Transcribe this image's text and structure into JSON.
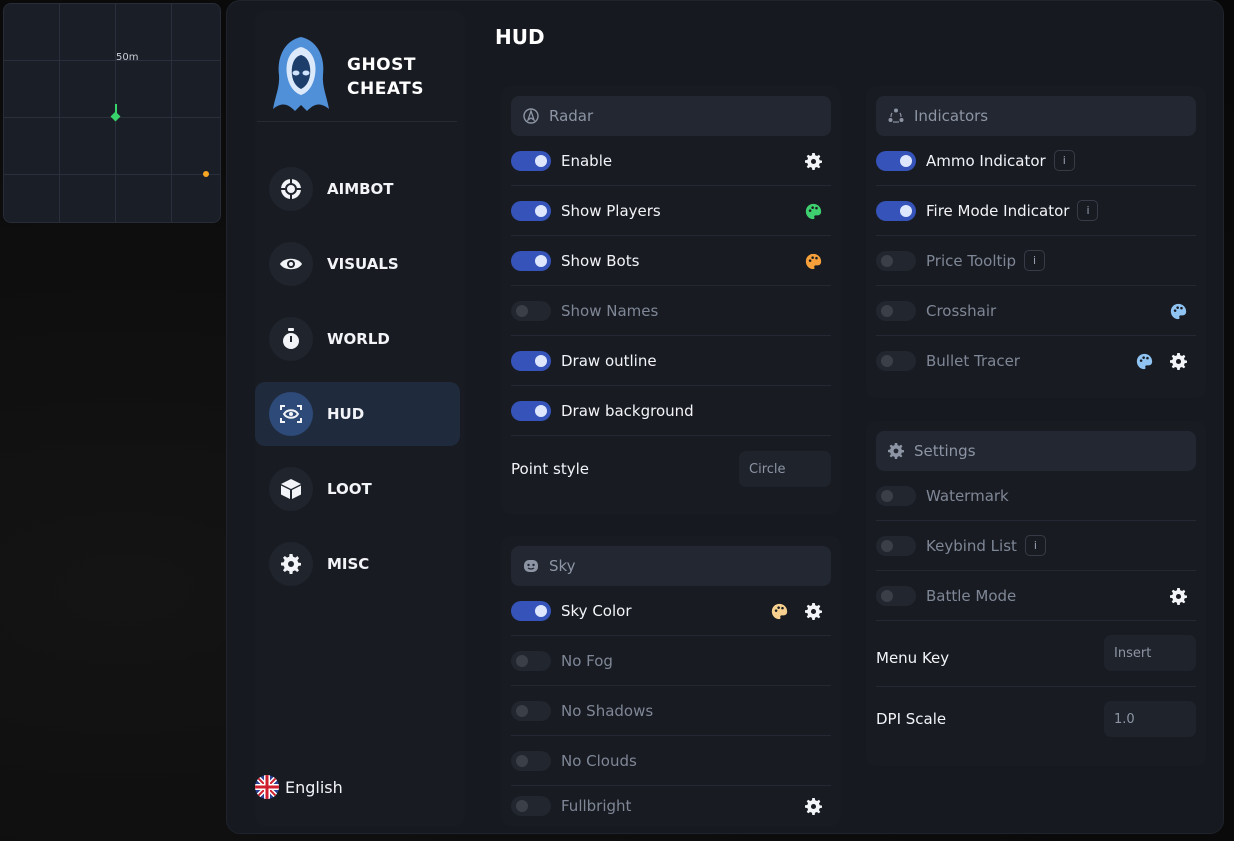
{
  "radar": {
    "range_label": "50m"
  },
  "brand": {
    "line1": "GHOST",
    "line2": "CHEATS"
  },
  "nav": [
    {
      "label": "AIMBOT",
      "icon": "crosshair-icon"
    },
    {
      "label": "VISUALS",
      "icon": "eye-icon"
    },
    {
      "label": "WORLD",
      "icon": "stopwatch-icon"
    },
    {
      "label": "HUD",
      "icon": "hud-eye-icon",
      "active": true
    },
    {
      "label": "LOOT",
      "icon": "box-icon"
    },
    {
      "label": "MISC",
      "icon": "gear-icon"
    }
  ],
  "language": {
    "label": "English"
  },
  "page_title": "HUD",
  "radar_panel": {
    "title": "Radar",
    "rows": [
      {
        "label": "Enable",
        "on": true
      },
      {
        "label": "Show Players",
        "on": true
      },
      {
        "label": "Show Bots",
        "on": true
      },
      {
        "label": "Show Names",
        "on": false
      },
      {
        "label": "Draw outline",
        "on": true
      },
      {
        "label": "Draw background",
        "on": true
      }
    ],
    "point_style": {
      "label": "Point style",
      "value": "Circle"
    }
  },
  "sky_panel": {
    "title": "Sky",
    "rows": [
      {
        "label": "Sky Color",
        "on": true
      },
      {
        "label": "No Fog",
        "on": false
      },
      {
        "label": "No Shadows",
        "on": false
      },
      {
        "label": "No Clouds",
        "on": false
      },
      {
        "label": "Fullbright",
        "on": false
      }
    ]
  },
  "indicators_panel": {
    "title": "Indicators",
    "rows": [
      {
        "label": "Ammo Indicator",
        "on": true,
        "info": "i"
      },
      {
        "label": "Fire Mode Indicator",
        "on": true,
        "info": "i"
      },
      {
        "label": "Price Tooltip",
        "on": false,
        "info": "i"
      },
      {
        "label": "Crosshair",
        "on": false
      },
      {
        "label": "Bullet Tracer",
        "on": false
      }
    ]
  },
  "settings_panel": {
    "title": "Settings",
    "rows": [
      {
        "label": "Watermark",
        "on": false
      },
      {
        "label": "Keybind List",
        "on": false,
        "info": "i"
      },
      {
        "label": "Battle Mode",
        "on": false
      }
    ],
    "menu_key": {
      "label": "Menu Key",
      "value": "Insert"
    },
    "dpi_scale": {
      "label": "DPI Scale",
      "value": "1.0"
    }
  },
  "colors": {
    "accent": "#3553b8",
    "palette_green": "#3ecf6e",
    "palette_orange": "#f5a03a",
    "palette_peach": "#f7cf8f",
    "palette_blue": "#8fc3f2"
  }
}
